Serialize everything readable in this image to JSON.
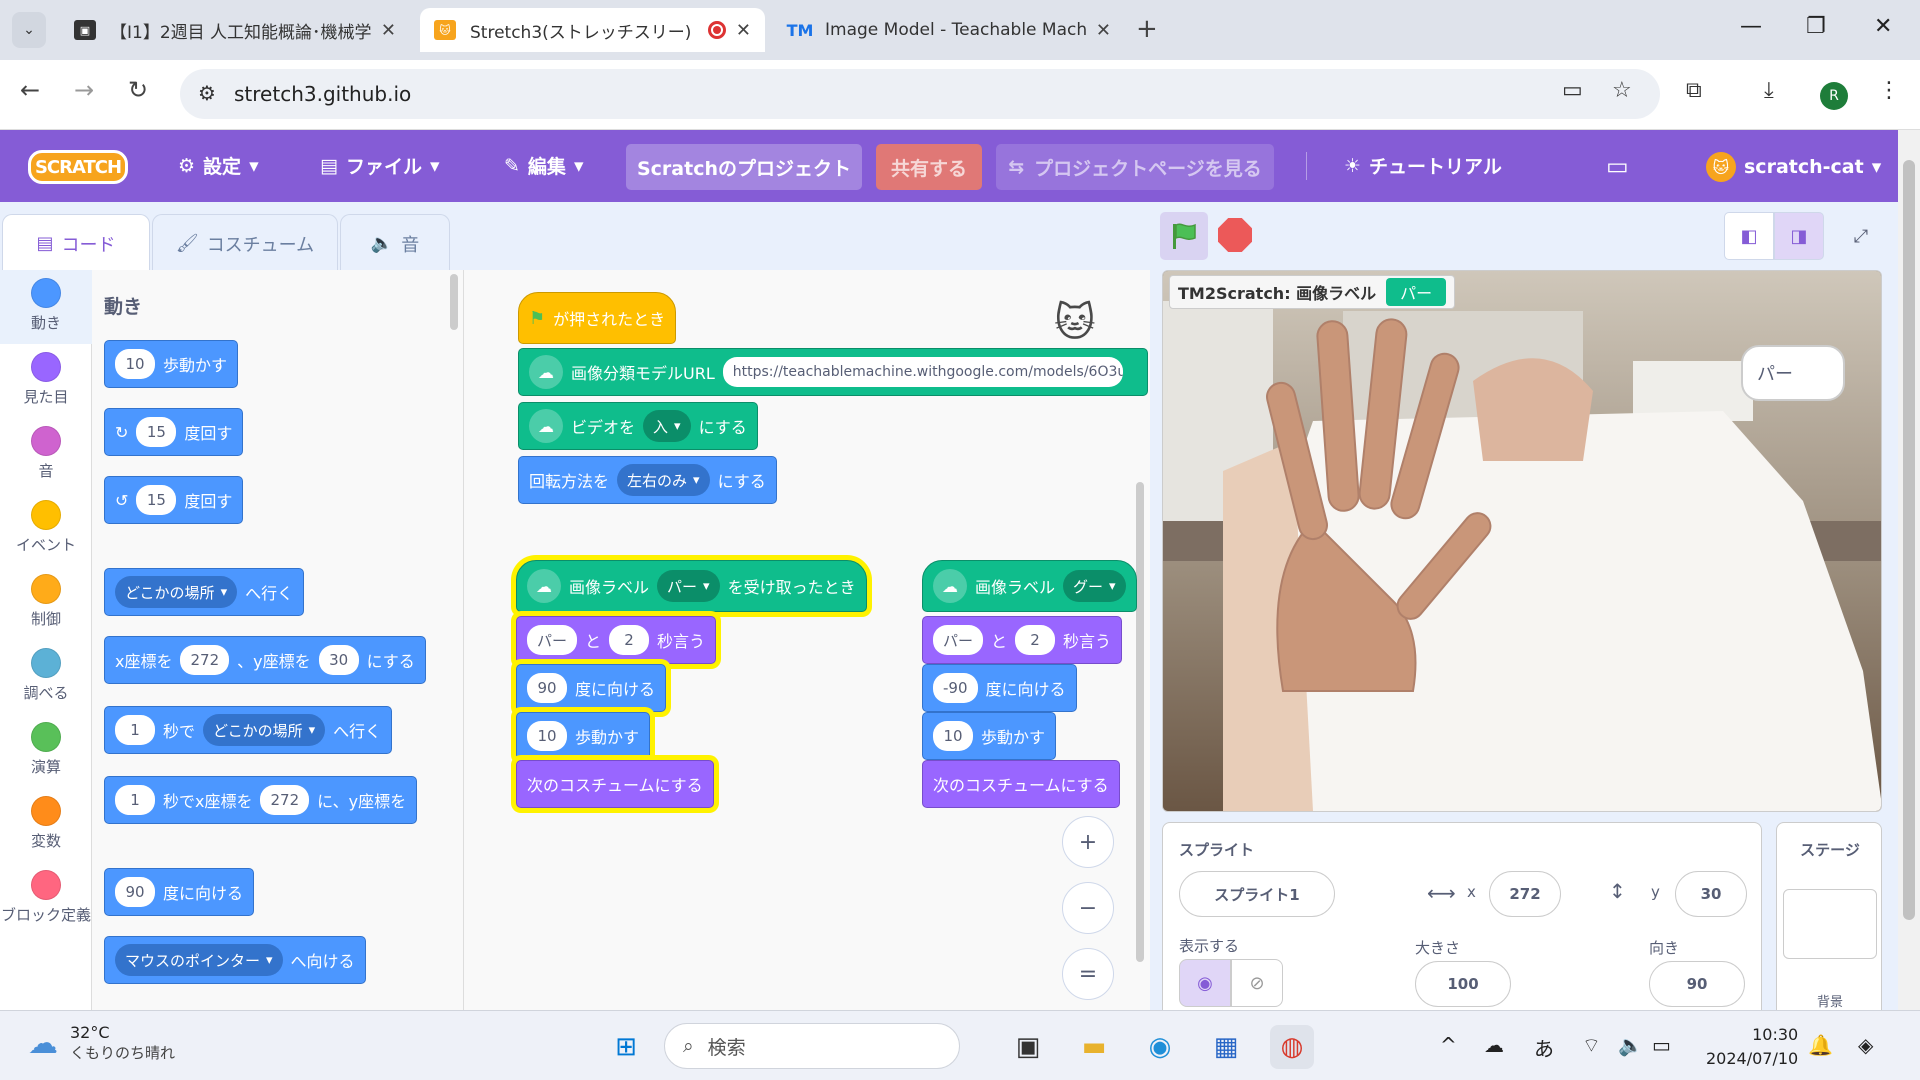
{
  "browser": {
    "tabs": [
      {
        "title": "【I1】2週目 人工知能概論･機械学習",
        "favicon": "document-icon"
      },
      {
        "title": "Stretch3(ストレッチスリー)",
        "favicon": "scratch-cat-icon"
      },
      {
        "title": "Image Model - Teachable Machine",
        "favicon": "tm-icon",
        "favicon_text": "TM"
      }
    ],
    "url": "stretch3.github.io",
    "profile_initial": "R",
    "controls": {
      "minimize": "—",
      "restore": "❐",
      "close": "✕",
      "newtab": "+",
      "close_tab": "✕"
    }
  },
  "scratch_menu": {
    "logo": "SCRATCH",
    "settings": "設定",
    "file": "ファイル",
    "edit": "編集",
    "project_title": "Scratchのプロジェクト",
    "share": "共有する",
    "see_project_page": "プロジェクトページを見る",
    "tutorials": "チュートリアル",
    "username": "scratch-cat"
  },
  "editor_tabs": {
    "code": "コード",
    "costumes": "コスチューム",
    "sounds": "音"
  },
  "categories": [
    {
      "label": "動き",
      "color": "#4c97ff"
    },
    {
      "label": "見た目",
      "color": "#9966ff"
    },
    {
      "label": "音",
      "color": "#cf63cf"
    },
    {
      "label": "イベント",
      "color": "#ffbf00"
    },
    {
      "label": "制御",
      "color": "#ffab19"
    },
    {
      "label": "調べる",
      "color": "#5cb1d6"
    },
    {
      "label": "演算",
      "color": "#59c059"
    },
    {
      "label": "変数",
      "color": "#ff8c1a"
    },
    {
      "label": "ブロック定義",
      "color": "#ff6680"
    }
  ],
  "palette": {
    "title": "動き",
    "move": {
      "value": "10",
      "text": "歩動かす"
    },
    "turn_right": {
      "value": "15",
      "text": "度回す"
    },
    "turn_left": {
      "value": "15",
      "text": "度回す"
    },
    "goto": {
      "option": "どこかの場所",
      "text": "へ行く"
    },
    "gotoxy": {
      "x_label": "x座標を",
      "x": "272",
      "y_label": "、y座標を",
      "y": "30",
      "text": "にする"
    },
    "glide": {
      "secs": "1",
      "mid": "秒で",
      "option": "どこかの場所",
      "text": "へ行く"
    },
    "glidexy": {
      "secs": "1",
      "mid": "秒でx座標を",
      "x": "272",
      "text": "に、y座標を"
    },
    "point": {
      "value": "90",
      "text": "度に向ける"
    },
    "point_towards": {
      "option": "マウスのポインター",
      "text": "へ向ける"
    }
  },
  "workspace": {
    "script1": {
      "hat": "が押されたとき",
      "url_label": "画像分類モデルURL",
      "url_value": "https://teachablemachine.withgoogle.com/models/6O3u",
      "video_label": "ビデオを",
      "video_option": "入",
      "video_suffix": "にする",
      "rot_label": "回転方法を",
      "rot_option": "左右のみ",
      "rot_suffix": "にする"
    },
    "script2": {
      "hat_label": "画像ラベル",
      "hat_option": "パー",
      "hat_suffix": "を受け取ったとき",
      "say_text": "パー",
      "say_and": "と",
      "say_secs": "2",
      "say_suffix": "秒言う",
      "dir": "90",
      "dir_suffix": "度に向ける",
      "steps": "10",
      "steps_suffix": "歩動かす",
      "costume": "次のコスチュームにする"
    },
    "script3": {
      "hat_label": "画像ラベル",
      "hat_option": "グー",
      "say_text": "パー",
      "say_and": "と",
      "say_secs": "2",
      "say_suffix": "秒言う",
      "dir": "-90",
      "dir_suffix": "度に向ける",
      "steps": "10",
      "steps_suffix": "歩動かす",
      "costume": "次のコスチュームにする"
    },
    "zoom": {
      "in": "+",
      "out": "−",
      "reset": "="
    }
  },
  "stage": {
    "monitor_label": "TM2Scratch: 画像ラベル",
    "monitor_value": "パー",
    "speech": "パー"
  },
  "sprite_info": {
    "title": "スプライト",
    "name": "スプライト1",
    "x_label": "x",
    "x": "272",
    "y_label": "y",
    "y": "30",
    "show_label": "表示する",
    "size_label": "大きさ",
    "size": "100",
    "direction_label": "向き",
    "direction": "90",
    "stage_label": "ステージ",
    "backdrop_label": "背景"
  },
  "taskbar": {
    "temperature": "32°C",
    "weather": "くもりのち晴れ",
    "search_placeholder": "検索",
    "ime": "あ",
    "time": "10:30",
    "date": "2024/07/10"
  }
}
